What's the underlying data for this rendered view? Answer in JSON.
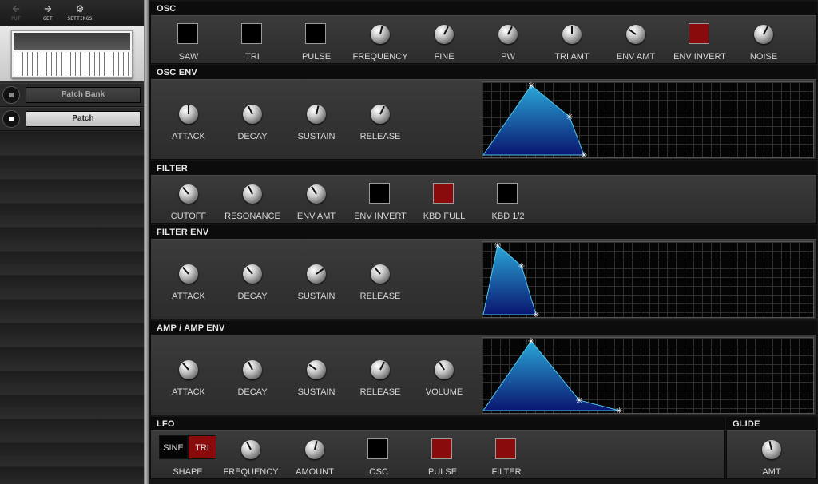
{
  "toolbar": {
    "put": {
      "label": "PUT",
      "icon": "arrow-left-icon",
      "enabled": false
    },
    "get": {
      "label": "GET",
      "icon": "arrow-right-icon"
    },
    "settings": {
      "label": "SETTINGS",
      "icon": "gear-icon"
    }
  },
  "sidebar": {
    "patch_bank_label": "Patch Bank",
    "patch_label": "Patch",
    "selected": "Patch"
  },
  "sections": {
    "osc": {
      "title": "OSC",
      "controls": [
        {
          "label": "SAW",
          "type": "toggle",
          "on": false
        },
        {
          "label": "TRI",
          "type": "toggle",
          "on": false
        },
        {
          "label": "PULSE",
          "type": "toggle",
          "on": false
        },
        {
          "label": "FREQUENCY",
          "type": "knob",
          "value": 0.55
        },
        {
          "label": "FINE",
          "type": "knob",
          "value": 0.6
        },
        {
          "label": "PW",
          "type": "knob",
          "value": 0.6
        },
        {
          "label": "TRI AMT",
          "type": "knob",
          "value": 0.5
        },
        {
          "label": "ENV AMT",
          "type": "knob",
          "value": 0.3
        },
        {
          "label": "ENV INVERT",
          "type": "toggle",
          "on": true
        },
        {
          "label": "NOISE",
          "type": "knob",
          "value": 0.6
        }
      ]
    },
    "osc_env": {
      "title": "OSC ENV",
      "controls": [
        {
          "label": "ATTACK",
          "type": "knob",
          "value": 0.5
        },
        {
          "label": "DECAY",
          "type": "knob",
          "value": 0.4
        },
        {
          "label": "SUSTAIN",
          "type": "knob",
          "value": 0.55
        },
        {
          "label": "RELEASE",
          "type": "knob",
          "value": 0.6
        }
      ],
      "envelope": {
        "attack": 0.5,
        "decay": 0.4,
        "sustain": 0.55,
        "release": 0.15
      }
    },
    "filter": {
      "title": "FILTER",
      "controls": [
        {
          "label": "CUTOFF",
          "type": "knob",
          "value": 0.35
        },
        {
          "label": "RESONANCE",
          "type": "knob",
          "value": 0.4
        },
        {
          "label": "ENV AMT",
          "type": "knob",
          "value": 0.38
        },
        {
          "label": "ENV INVERT",
          "type": "toggle",
          "on": false
        },
        {
          "label": "KBD FULL",
          "type": "toggle",
          "on": true
        },
        {
          "label": "KBD 1/2",
          "type": "toggle",
          "on": false
        }
      ]
    },
    "filter_env": {
      "title": "FILTER ENV",
      "controls": [
        {
          "label": "ATTACK",
          "type": "knob",
          "value": 0.35
        },
        {
          "label": "DECAY",
          "type": "knob",
          "value": 0.35
        },
        {
          "label": "SUSTAIN",
          "type": "knob",
          "value": 0.7
        },
        {
          "label": "RELEASE",
          "type": "knob",
          "value": 0.35
        }
      ],
      "envelope": {
        "attack": 0.15,
        "decay": 0.25,
        "sustain": 0.7,
        "release": 0.15
      }
    },
    "amp": {
      "title": "AMP / AMP ENV",
      "controls": [
        {
          "label": "ATTACK",
          "type": "knob",
          "value": 0.35
        },
        {
          "label": "DECAY",
          "type": "knob",
          "value": 0.4
        },
        {
          "label": "SUSTAIN",
          "type": "knob",
          "value": 0.3
        },
        {
          "label": "RELEASE",
          "type": "knob",
          "value": 0.6
        },
        {
          "label": "VOLUME",
          "type": "knob",
          "value": 0.38
        }
      ],
      "envelope": {
        "attack": 0.5,
        "decay": 0.5,
        "sustain": 0.15,
        "release": 0.42
      }
    },
    "lfo": {
      "title": "LFO",
      "shape": {
        "label": "SHAPE",
        "options": [
          "SINE",
          "TRI"
        ],
        "selected": "TRI"
      },
      "controls": [
        {
          "label": "FREQUENCY",
          "type": "knob",
          "value": 0.4
        },
        {
          "label": "AMOUNT",
          "type": "knob",
          "value": 0.55
        },
        {
          "label": "OSC",
          "type": "toggle",
          "on": false
        },
        {
          "label": "PULSE",
          "type": "toggle",
          "on": true
        },
        {
          "label": "FILTER",
          "type": "toggle",
          "on": true
        }
      ]
    },
    "glide": {
      "title": "GLIDE",
      "controls": [
        {
          "label": "AMT",
          "type": "knob",
          "value": 0.45
        }
      ]
    }
  },
  "colors": {
    "toggle_on": "#8a0b0b",
    "toggle_off": "#000000",
    "env_fill_top": "#2aa7d8",
    "env_fill_bottom": "#0a1670",
    "section_header": "#0c0c0c"
  }
}
